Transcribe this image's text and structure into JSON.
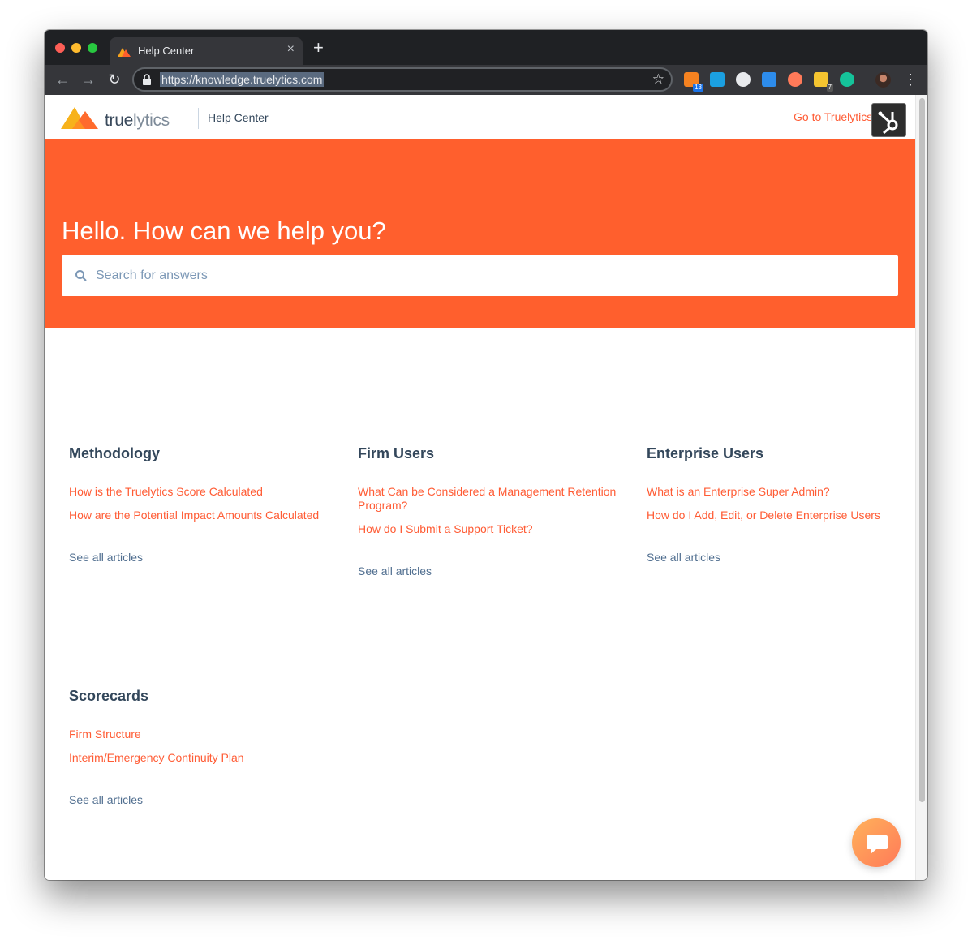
{
  "browser": {
    "tab_title": "Help Center",
    "url": "https://knowledge.truelytics.com",
    "extensions": [
      {
        "icon": "hubspot-sales-icon",
        "color": "#f58220",
        "badge": "13",
        "badge_color": "#1a73e8"
      },
      {
        "icon": "dashlane-icon",
        "color": "#1ba0e1",
        "badge": "",
        "badge_color": ""
      },
      {
        "icon": "record-icon",
        "color": "#e8eaed",
        "badge": "",
        "badge_color": ""
      },
      {
        "icon": "chat-extension-icon",
        "color": "#2d8ceb",
        "badge": "",
        "badge_color": ""
      },
      {
        "icon": "hubspot-icon",
        "color": "#ff7a59",
        "badge": "",
        "badge_color": ""
      },
      {
        "icon": "sticky-notes-icon",
        "color": "#f4c430",
        "badge": "7",
        "badge_color": "#555555"
      },
      {
        "icon": "grammarly-icon",
        "color": "#15c39a",
        "badge": "",
        "badge_color": ""
      }
    ]
  },
  "header": {
    "logo_text_bold": "true",
    "logo_text_light": "lytics",
    "title": "Help Center",
    "go_link": "Go to Truelytics"
  },
  "hero": {
    "title": "Hello. How can we help you?",
    "search_placeholder": "Search for answers"
  },
  "categories": [
    {
      "title": "Methodology",
      "articles": [
        "How is the Truelytics Score Calculated",
        "How are the Potential Impact Amounts Calculated"
      ],
      "see_all": "See all articles"
    },
    {
      "title": "Firm Users",
      "articles": [
        "What Can be Considered a Management Retention Program?",
        "How do I Submit a Support Ticket?"
      ],
      "see_all": "See all articles"
    },
    {
      "title": "Enterprise Users",
      "articles": [
        "What is an Enterprise Super Admin?",
        "How do I Add, Edit, or Delete Enterprise Users"
      ],
      "see_all": "See all articles"
    },
    {
      "title": "Scorecards",
      "articles": [
        "Firm Structure",
        "Interim/Emergency Continuity Plan"
      ],
      "see_all": "See all articles"
    }
  ],
  "colors": {
    "brand_orange": "#ff5f2d",
    "link_orange": "#ff5c35",
    "heading": "#33475b",
    "muted_link": "#516f90"
  }
}
